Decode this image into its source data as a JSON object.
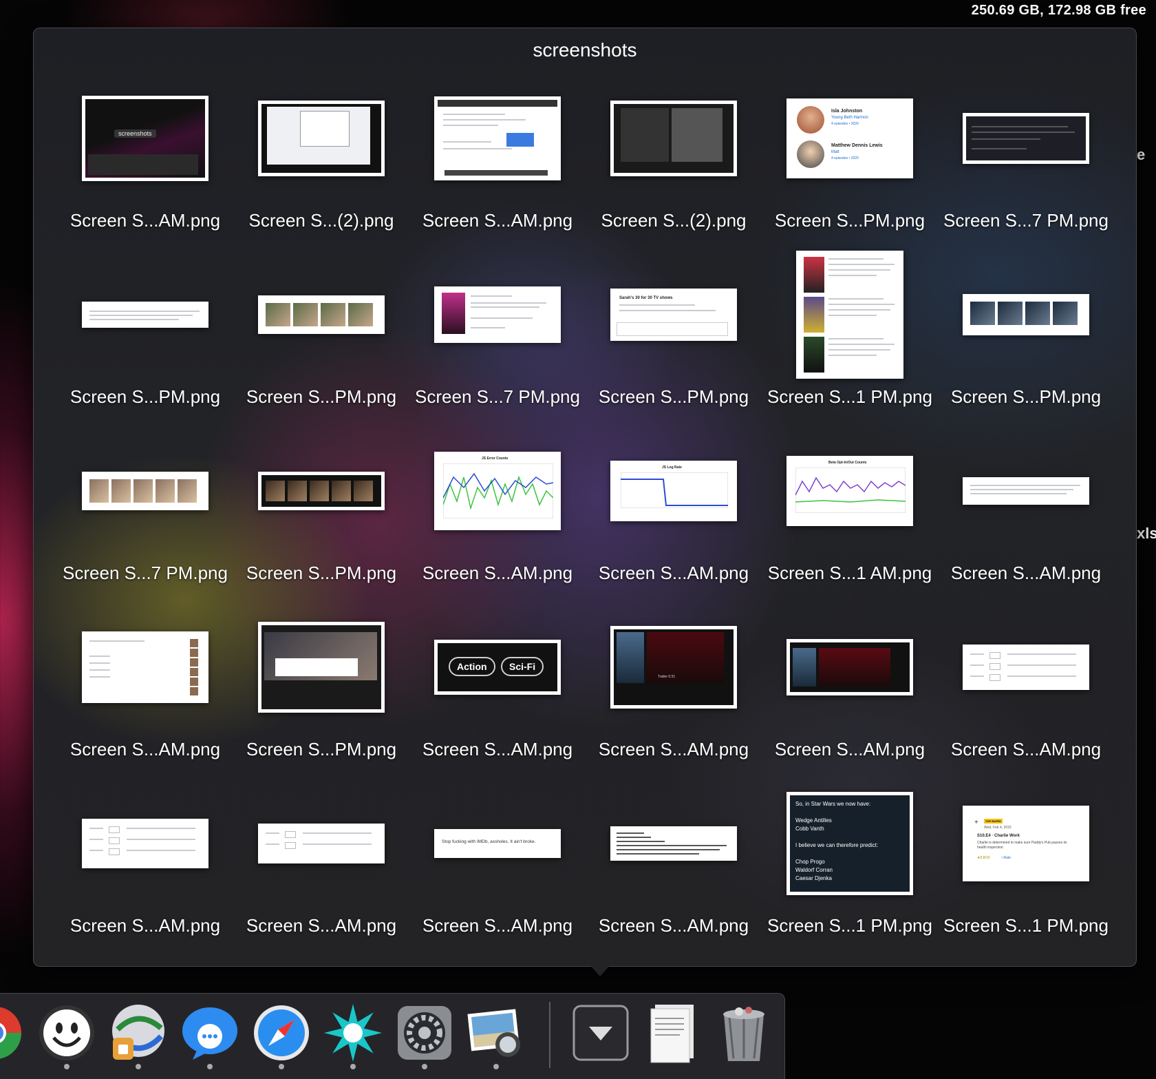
{
  "menu_bar": {
    "disk_status": "250.69 GB, 172.98 GB free"
  },
  "desktop": {
    "edge_label_1": "e",
    "edge_label_2": "xls"
  },
  "stack": {
    "title": "screenshots",
    "rows": [
      [
        {
          "name": "Screen S...AM.png",
          "kind": "dark-stack",
          "w": 184,
          "h": 124
        },
        {
          "name": "Screen S...(2).png",
          "kind": "dark-window",
          "w": 184,
          "h": 110
        },
        {
          "name": "Screen S...AM.png",
          "kind": "browser",
          "w": 184,
          "h": 122
        },
        {
          "name": "Screen S...(2).png",
          "kind": "dark-window2",
          "w": 184,
          "h": 110
        },
        {
          "name": "Screen S...PM.png",
          "kind": "cast",
          "w": 184,
          "h": 116
        },
        {
          "name": "Screen S...7 PM.png",
          "kind": "dark-card",
          "w": 184,
          "h": 74
        }
      ],
      [
        {
          "name": "Screen S...PM.png",
          "kind": "text-strip",
          "w": 184,
          "h": 38
        },
        {
          "name": "Screen S...PM.png",
          "kind": "photos4",
          "w": 184,
          "h": 56
        },
        {
          "name": "Screen S...7 PM.png",
          "kind": "show-card",
          "w": 184,
          "h": 82
        },
        {
          "name": "Screen S...PM.png",
          "kind": "list-card",
          "w": 184,
          "h": 76
        },
        {
          "name": "Screen S...1 PM.png",
          "kind": "posters",
          "w": 156,
          "h": 186
        },
        {
          "name": "Screen S...PM.png",
          "kind": "photos4dark",
          "w": 184,
          "h": 60
        }
      ],
      [
        {
          "name": "Screen S...7 PM.png",
          "kind": "photos5",
          "w": 184,
          "h": 56
        },
        {
          "name": "Screen S...PM.png",
          "kind": "filmstrip",
          "w": 184,
          "h": 56
        },
        {
          "name": "Screen S...AM.png",
          "kind": "chart-green",
          "w": 184,
          "h": 114
        },
        {
          "name": "Screen S...AM.png",
          "kind": "chart-step",
          "w": 184,
          "h": 88
        },
        {
          "name": "Screen S...1 AM.png",
          "kind": "chart-purple",
          "w": 184,
          "h": 102
        },
        {
          "name": "Screen S...AM.png",
          "kind": "text-note",
          "w": 184,
          "h": 40
        }
      ],
      [
        {
          "name": "Screen S...AM.png",
          "kind": "cast-list",
          "w": 184,
          "h": 104
        },
        {
          "name": "Screen S...PM.png",
          "kind": "movie-page",
          "w": 184,
          "h": 132
        },
        {
          "name": "Screen S...AM.png",
          "kind": "genres",
          "w": 184,
          "h": 80
        },
        {
          "name": "Screen S...AM.png",
          "kind": "movie-dark",
          "w": 184,
          "h": 120
        },
        {
          "name": "Screen S...AM.png",
          "kind": "movie-dark2",
          "w": 184,
          "h": 82
        },
        {
          "name": "Screen S...AM.png",
          "kind": "table",
          "w": 184,
          "h": 66
        }
      ],
      [
        {
          "name": "Screen S...AM.png",
          "kind": "table2",
          "w": 184,
          "h": 72
        },
        {
          "name": "Screen S...AM.png",
          "kind": "table3",
          "w": 184,
          "h": 58
        },
        {
          "name": "Screen S...AM.png",
          "kind": "quote",
          "w": 184,
          "h": 42
        },
        {
          "name": "Screen S...AM.png",
          "kind": "code",
          "w": 184,
          "h": 50
        },
        {
          "name": "Screen S...1 PM.png",
          "kind": "starwars",
          "w": 184,
          "h": 150
        },
        {
          "name": "Screen S...1 PM.png",
          "kind": "episode",
          "w": 184,
          "h": 110
        }
      ]
    ],
    "thumb_text": {
      "stack_label": "screenshots",
      "cast_1_name": "Isla Johnston",
      "cast_1_role": "Young Beth Harmon",
      "cast_1_eps": "4 episodes • 2020",
      "cast_2_name": "Matthew Dennis Lewis",
      "cast_2_role": "Matt",
      "cast_2_eps": "4 episodes • 2020",
      "list_title": "Sarah's 30 for 30 TV shows",
      "chart_1_title": "JS Error Counts",
      "chart_2_title": "JS Log Rate",
      "chart_3_title": "Beta Opt-In/Out Counts",
      "genre_1": "Action",
      "genre_2": "Sci-Fi",
      "trailer_label": "Trailer 0:31",
      "quote_text": "Stop fucking with IMDb, assholes. It ain't broke.",
      "sw_line_1": "So, in Star Wars we now have:",
      "sw_line_2": "Wedge Antilles",
      "sw_line_3": "Cobb Vanth",
      "sw_line_4": "I believe we can therefore predict:",
      "sw_line_5": "Chop Progo",
      "sw_line_6": "Waldorf Corran",
      "sw_line_7": "Caesar Djenka",
      "ep_badge": "TOP-RATED",
      "ep_date": "Wed, Feb 4, 2015",
      "ep_title": "S10.E4 · Charlie Work",
      "ep_desc": "Charlie is determined to make sure Paddy's Pub passes its health inspection.",
      "ep_rating": "★9.8/10",
      "ep_rate": "☆Rate"
    }
  },
  "dock": {
    "apps": [
      {
        "name": "chrome",
        "running": false
      },
      {
        "name": "finder-like",
        "running": true
      },
      {
        "name": "vpn",
        "running": true
      },
      {
        "name": "messages",
        "running": true
      },
      {
        "name": "safari",
        "running": true
      },
      {
        "name": "perforce",
        "running": true
      },
      {
        "name": "system-preferences",
        "running": true
      },
      {
        "name": "preview",
        "running": true
      }
    ],
    "stacks": [
      "downloads",
      "documents",
      "trash"
    ]
  },
  "colors": {
    "accent_green": "#3cc43c",
    "accent_blue": "#2a4cd6",
    "accent_purple": "#7a40d0"
  }
}
